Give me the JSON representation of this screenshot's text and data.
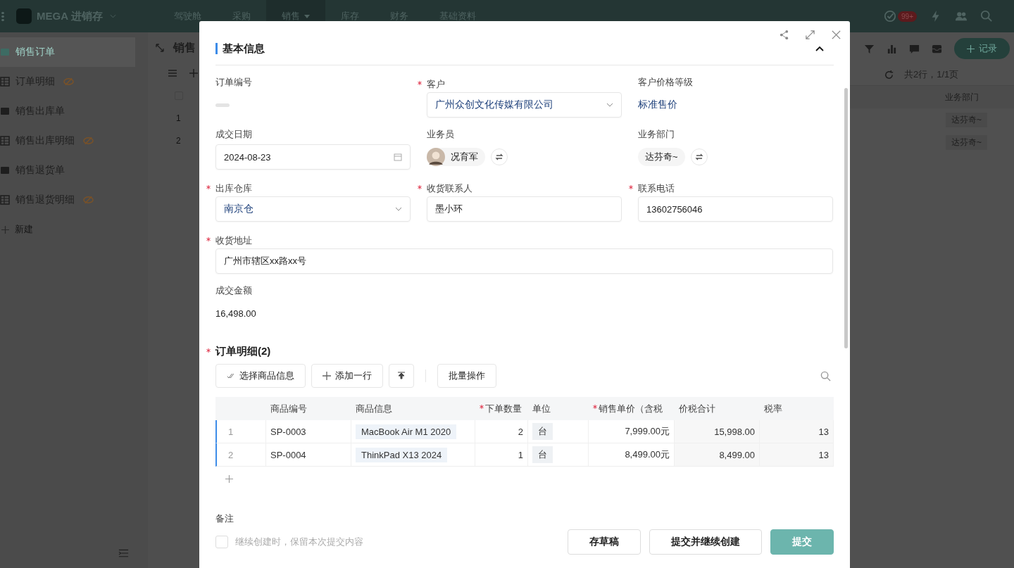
{
  "top_nav": {
    "app_name": "MEGA 进销存",
    "menus": [
      {
        "label": "驾驶舱",
        "selected": false
      },
      {
        "label": "采购",
        "selected": false
      },
      {
        "label": "销售",
        "selected": true
      },
      {
        "label": "库存",
        "selected": false
      },
      {
        "label": "财务",
        "selected": false
      },
      {
        "label": "基础资料",
        "selected": false
      }
    ],
    "badge": "99+"
  },
  "sidebar": {
    "items": [
      {
        "label": "销售订单",
        "selected": true,
        "hidden": false,
        "kind": "form"
      },
      {
        "label": "订单明细",
        "selected": false,
        "hidden": true,
        "kind": "table"
      },
      {
        "label": "销售出库单",
        "selected": false,
        "hidden": false,
        "kind": "form"
      },
      {
        "label": "销售出库明细",
        "selected": false,
        "hidden": true,
        "kind": "table"
      },
      {
        "label": "销售退货单",
        "selected": false,
        "hidden": false,
        "kind": "form"
      },
      {
        "label": "销售退货明细",
        "selected": false,
        "hidden": true,
        "kind": "table"
      }
    ],
    "new_label": "新建"
  },
  "view": {
    "title": "销售",
    "header_checked": false,
    "add_button": "记录",
    "pager": "共2行，1/1页",
    "row_numbers": [
      "1",
      "2"
    ],
    "column": "业务部门",
    "cells": [
      "达芬奇~",
      "达芬奇~"
    ]
  },
  "modal": {
    "section_title": "基本信息",
    "fields": [
      {
        "kind": "empty",
        "label": "订单编号",
        "required": false
      },
      {
        "kind": "select",
        "label": "客户",
        "required": true,
        "value": "广州众创文化传媒有限公司"
      },
      {
        "kind": "link",
        "label": "客户价格等级",
        "required": false,
        "value": "标准售价"
      },
      {
        "kind": "date",
        "label": "成交日期",
        "required": false,
        "value": "2024-08-23"
      },
      {
        "kind": "member",
        "label": "业务员",
        "required": false,
        "value": "况育军"
      },
      {
        "kind": "dept",
        "label": "业务部门",
        "required": false,
        "value": "达芬奇~"
      },
      {
        "kind": "select",
        "label": "出库仓库",
        "required": true,
        "value": "南京仓"
      },
      {
        "kind": "input",
        "label": "收货联系人",
        "required": true,
        "value": "墨小环"
      },
      {
        "kind": "input",
        "label": "联系电话",
        "required": true,
        "value": "13602756046"
      },
      {
        "kind": "wide",
        "label": "收货地址",
        "required": true,
        "value": "广州市辖区xx路xx号"
      },
      {
        "kind": "text",
        "label": "成交金额",
        "required": false,
        "value": "16,498.00"
      }
    ],
    "details": {
      "title": "订单明细(2)",
      "required": true,
      "buttons": [
        "选择商品信息",
        "添加一行",
        "批量操作"
      ],
      "columns": [
        {
          "label": "商品编号",
          "required": false
        },
        {
          "label": "商品信息",
          "required": false
        },
        {
          "label": "下单数量",
          "required": true
        },
        {
          "label": "单位",
          "required": false
        },
        {
          "label": "销售单价（含税",
          "required": true
        },
        {
          "label": "价税合计",
          "required": false
        },
        {
          "label": "税率",
          "required": false
        }
      ],
      "rows": [
        {
          "num": "1",
          "code": "SP-0003",
          "product": "MacBook Air M1 2020",
          "qty": "2",
          "unit": "台",
          "price": "7,999.00元",
          "total": "15,998.00",
          "tax": "13"
        },
        {
          "num": "2",
          "code": "SP-0004",
          "product": "ThinkPad X13 2024",
          "qty": "1",
          "unit": "台",
          "price": "8,499.00元",
          "total": "8,499.00",
          "tax": "13"
        }
      ]
    },
    "remark_label": "备注",
    "keep_option": {
      "label": "继续创建时，保留本次提交内容",
      "checked": false
    },
    "actions": [
      {
        "label": "存草稿",
        "kind": "default"
      },
      {
        "label": "提交并继续创建",
        "kind": "default"
      },
      {
        "label": "提交",
        "kind": "primary"
      }
    ]
  }
}
